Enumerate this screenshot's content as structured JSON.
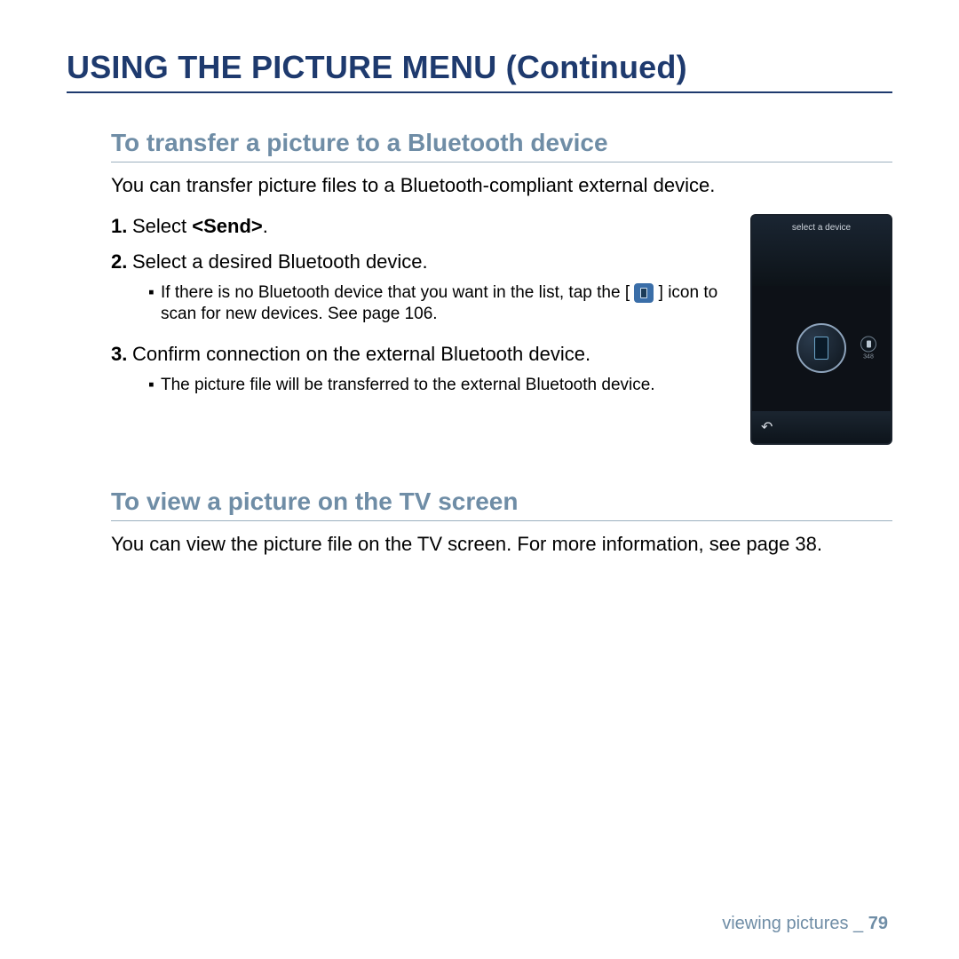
{
  "title": "USING THE PICTURE MENU (Continued)",
  "section1": {
    "heading": "To transfer a picture to a Bluetooth device",
    "intro": "You can transfer picture files to a Bluetooth-compliant external device.",
    "step1_num": "1.",
    "step1_pre": "Select ",
    "step1_bold": "<Send>",
    "step1_post": ".",
    "step2_num": "2.",
    "step2_text": "Select a desired Bluetooth device.",
    "step2_sub_pre": "If there is no Bluetooth device that you want in the list, tap the [ ",
    "step2_sub_post": " ] icon to scan for new devices. See page 106.",
    "step3_num": "3.",
    "step3_text": "Confirm connection on the external Bluetooth device.",
    "step3_sub": "The picture file will be transferred to the external Bluetooth device."
  },
  "device": {
    "header": "select a device",
    "small_label": "348"
  },
  "section2": {
    "heading": "To view a picture on the TV screen",
    "intro": "You can view the picture file on the TV screen. For more information, see page 38."
  },
  "footer": {
    "section": "viewing pictures",
    "sep": " _ ",
    "page": "79"
  }
}
